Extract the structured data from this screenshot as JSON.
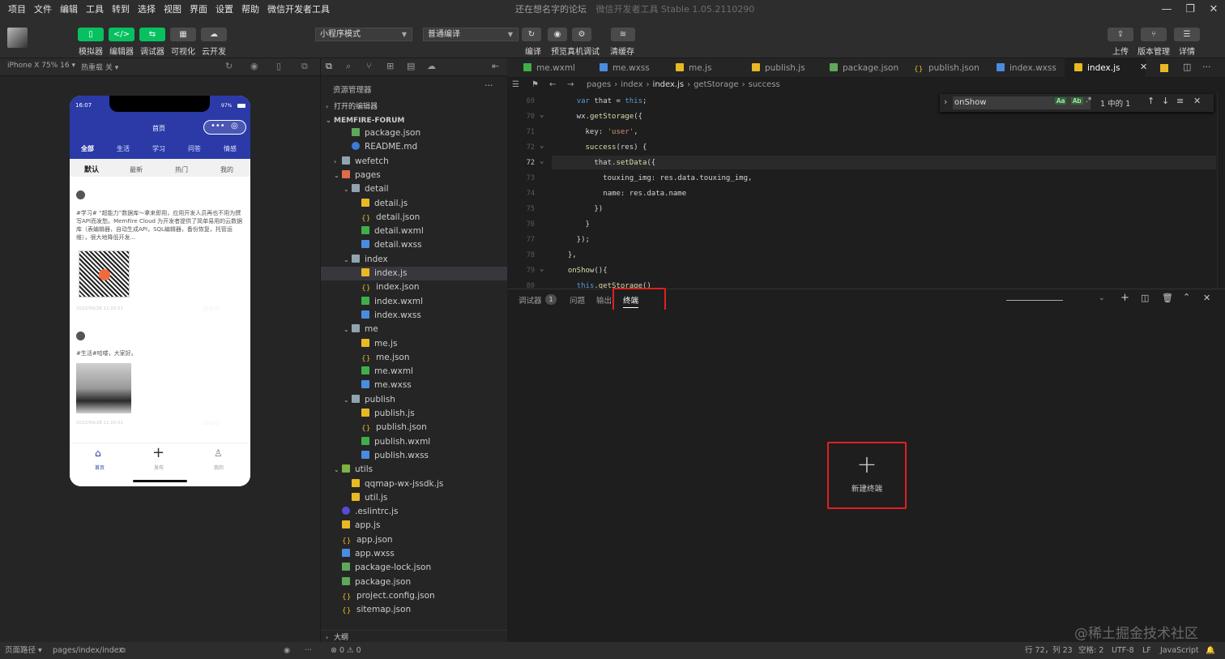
{
  "menubar": {
    "items": [
      "项目",
      "文件",
      "编辑",
      "工具",
      "转到",
      "选择",
      "视图",
      "界面",
      "设置",
      "帮助",
      "微信开发者工具"
    ],
    "title": "还在想名字的论坛",
    "subtitle": "微信开发者工具 Stable 1.05.2110290"
  },
  "toolbar": {
    "buttons": [
      {
        "label": "模拟器",
        "icon": "phone-icon"
      },
      {
        "label": "编辑器",
        "icon": "code-icon"
      },
      {
        "label": "调试器",
        "icon": "debug-icon"
      },
      {
        "label": "可视化",
        "icon": "layout-icon"
      },
      {
        "label": "云开发",
        "icon": "cloud-icon"
      }
    ],
    "mode_select": "小程序模式",
    "compile_select": "普通编译",
    "actions": [
      "编译",
      "预览",
      "真机调试",
      "清缓存"
    ],
    "right_actions": [
      "上传",
      "版本管理",
      "详情"
    ]
  },
  "simulator": {
    "device": "iPhone X 75% 16 ▾",
    "hot_reload": "热重载 关 ▾",
    "status_time": "16:07",
    "battery": "97%",
    "page_title": "首页",
    "category_tabs": [
      "全部",
      "生活",
      "学习",
      "问答",
      "情感"
    ],
    "sort_tabs": [
      "默认",
      "最新",
      "热门",
      "我的"
    ],
    "post1_text": "#学习# “超能力”数据库～拿来即用，应用开发人员再也不用为撰写API而发愁。MemFire Cloud 为开发者提供了简单易用的云数据库（表编辑器，自动生成API，SQL编辑器，备份恢复，托管运维），很大地降低开发...",
    "post1_time": "2022/09/28 11:10:51",
    "post2_text": "#生活#哈喽，大家好。",
    "post2_time": "2022/09/28 11:10:51",
    "nav": [
      "首页",
      "发布",
      "我的"
    ]
  },
  "explorer": {
    "title": "资源管理器",
    "open_editors": "打开的编辑器",
    "project": "MEMFIRE-FORUM",
    "outline": "大纲",
    "tree": [
      {
        "label": "package.json",
        "depth": 2,
        "type": "json-green"
      },
      {
        "label": "README.md",
        "depth": 2,
        "type": "info"
      },
      {
        "label": "wefetch",
        "depth": 1,
        "type": "folder",
        "chev": "›"
      },
      {
        "label": "pages",
        "depth": 1,
        "type": "folder-red",
        "chev": "⌄"
      },
      {
        "label": "detail",
        "depth": 2,
        "type": "folder",
        "chev": "⌄"
      },
      {
        "label": "detail.js",
        "depth": 3,
        "type": "js"
      },
      {
        "label": "detail.json",
        "depth": 3,
        "type": "braces"
      },
      {
        "label": "detail.wxml",
        "depth": 3,
        "type": "wxml"
      },
      {
        "label": "detail.wxss",
        "depth": 3,
        "type": "wxss"
      },
      {
        "label": "index",
        "depth": 2,
        "type": "folder",
        "chev": "⌄"
      },
      {
        "label": "index.js",
        "depth": 3,
        "type": "js",
        "selected": true
      },
      {
        "label": "index.json",
        "depth": 3,
        "type": "braces"
      },
      {
        "label": "index.wxml",
        "depth": 3,
        "type": "wxml"
      },
      {
        "label": "index.wxss",
        "depth": 3,
        "type": "wxss"
      },
      {
        "label": "me",
        "depth": 2,
        "type": "folder",
        "chev": "⌄"
      },
      {
        "label": "me.js",
        "depth": 3,
        "type": "js"
      },
      {
        "label": "me.json",
        "depth": 3,
        "type": "braces"
      },
      {
        "label": "me.wxml",
        "depth": 3,
        "type": "wxml"
      },
      {
        "label": "me.wxss",
        "depth": 3,
        "type": "wxss"
      },
      {
        "label": "publish",
        "depth": 2,
        "type": "folder",
        "chev": "⌄"
      },
      {
        "label": "publish.js",
        "depth": 3,
        "type": "js"
      },
      {
        "label": "publish.json",
        "depth": 3,
        "type": "braces"
      },
      {
        "label": "publish.wxml",
        "depth": 3,
        "type": "wxml"
      },
      {
        "label": "publish.wxss",
        "depth": 3,
        "type": "wxss"
      },
      {
        "label": "utils",
        "depth": 1,
        "type": "folder-green",
        "chev": "⌄"
      },
      {
        "label": "qqmap-wx-jssdk.js",
        "depth": 2,
        "type": "js"
      },
      {
        "label": "util.js",
        "depth": 2,
        "type": "js"
      },
      {
        "label": ".eslintrc.js",
        "depth": 1,
        "type": "eslint"
      },
      {
        "label": "app.js",
        "depth": 1,
        "type": "js"
      },
      {
        "label": "app.json",
        "depth": 1,
        "type": "braces"
      },
      {
        "label": "app.wxss",
        "depth": 1,
        "type": "wxss"
      },
      {
        "label": "package-lock.json",
        "depth": 1,
        "type": "json-green"
      },
      {
        "label": "package.json",
        "depth": 1,
        "type": "json-green"
      },
      {
        "label": "project.config.json",
        "depth": 1,
        "type": "braces"
      },
      {
        "label": "sitemap.json",
        "depth": 1,
        "type": "braces"
      }
    ]
  },
  "editor": {
    "tabs": [
      {
        "label": "me.wxml",
        "type": "wxml"
      },
      {
        "label": "me.wxss",
        "type": "wxss"
      },
      {
        "label": "me.js",
        "type": "js"
      },
      {
        "label": "publish.js",
        "type": "js"
      },
      {
        "label": "package.json",
        "type": "json-green"
      },
      {
        "label": "publish.json",
        "type": "braces"
      },
      {
        "label": "index.wxss",
        "type": "wxss"
      },
      {
        "label": "index.js",
        "type": "js",
        "active": true
      }
    ],
    "breadcrumb": [
      "pages",
      "index",
      "index.js",
      "getStorage",
      "success"
    ],
    "find_query": "onShow",
    "find_result": "1 中的 1",
    "current_line": "72",
    "code_lines": [
      {
        "n": "69",
        "text": "    var that = this;"
      },
      {
        "n": "70",
        "text": "    wx.getStorage({"
      },
      {
        "n": "71",
        "text": "      key: 'user',"
      },
      {
        "n": "72",
        "text": "      success(res) {"
      },
      {
        "n": "72",
        "text": "        that.setData({"
      },
      {
        "n": "73",
        "text": "          touxing_img: res.data.touxing_img,"
      },
      {
        "n": "74",
        "text": "          name: res.data.name"
      },
      {
        "n": "75",
        "text": "        })"
      },
      {
        "n": "76",
        "text": "      }"
      },
      {
        "n": "77",
        "text": "    });"
      },
      {
        "n": "78",
        "text": "  },"
      },
      {
        "n": "79",
        "text": "  onShow(){"
      },
      {
        "n": "80",
        "text": "    this.getStorage()"
      }
    ]
  },
  "panel": {
    "tabs": [
      "调试器",
      "问题",
      "输出",
      "终端"
    ],
    "debugger_badge": "1",
    "active_tab": "终端",
    "new_terminal": "新建终端"
  },
  "status": {
    "page_path_label": "页面路径 ▾",
    "page_path": "pages/index/index",
    "problems": "⊗ 0 ⚠ 0",
    "cursor": "行 72，列 23",
    "indent": "空格: 2",
    "encoding": "UTF-8",
    "eol": "LF",
    "language": "JavaScript"
  },
  "watermark": "@稀土掘金技术社区",
  "colors": {
    "accent": "#07c160",
    "highlight": "#e02020",
    "phone_header": "#2b3aa7"
  }
}
